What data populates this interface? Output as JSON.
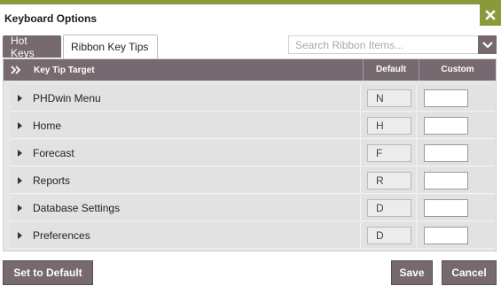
{
  "dialog": {
    "title": "Keyboard Options",
    "close_icon": "close-icon",
    "accent_color": "#8a9a3b"
  },
  "tabs": [
    {
      "label": "Hot Keys",
      "active": true
    },
    {
      "label": "Ribbon Key Tips",
      "active": false
    }
  ],
  "search": {
    "placeholder": "Search Ribbon Items...",
    "dropdown_icon": "chevron-down-icon"
  },
  "table": {
    "expand_icon": "double-chevron-right-icon",
    "columns": [
      "Key Tip Target",
      "Default",
      "Custom"
    ],
    "rows": [
      {
        "target": "PHDwin Menu",
        "default": "N",
        "custom": ""
      },
      {
        "target": "Home",
        "default": "H",
        "custom": ""
      },
      {
        "target": "Forecast",
        "default": "F",
        "custom": ""
      },
      {
        "target": "Reports",
        "default": "R",
        "custom": ""
      },
      {
        "target": "Database Settings",
        "default": "D",
        "custom": ""
      },
      {
        "target": "Preferences",
        "default": "D",
        "custom": ""
      }
    ]
  },
  "buttons": {
    "set_default": "Set to Default",
    "save": "Save",
    "cancel": "Cancel",
    "color": "#76696f"
  }
}
